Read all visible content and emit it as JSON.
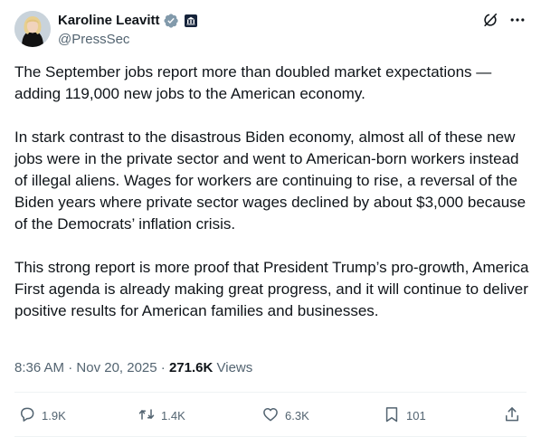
{
  "author": {
    "name": "Karoline Leavitt",
    "handle": "@PressSec"
  },
  "tweet": {
    "paragraphs": [
      "The September jobs report more than doubled market expectations — adding 119,000 new jobs to the American economy.",
      "In stark contrast to the disastrous Biden economy, almost all of these new jobs were in the private sector and went to American-born workers instead of illegal aliens. Wages for workers are continuing to rise, a reversal of the Biden years where private sector wages declined by about $3,000 because of the Democrats’ inflation crisis.",
      "This strong report is more proof that President Trump’s pro-growth, America First agenda is already making great progress, and it will continue to deliver positive results for American families and businesses."
    ]
  },
  "meta": {
    "time": "8:36 AM",
    "dot1": " · ",
    "date": "Nov 20, 2025",
    "dot2": " · ",
    "views_count": "271.6K",
    "views_label": " Views"
  },
  "actions": {
    "replies": "1.9K",
    "reposts": "1.4K",
    "likes": "6.3K",
    "bookmarks": "101"
  },
  "colors": {
    "text": "#0f1419",
    "secondary": "#536471",
    "verified": "#829aab",
    "divider": "#eff3f4"
  },
  "icons": {
    "verified": "verified-badge-icon",
    "affiliation": "government-affiliation-icon",
    "grok": "grok-icon",
    "more": "more-icon",
    "reply": "reply-icon",
    "repost": "repost-icon",
    "like": "heart-icon",
    "bookmark": "bookmark-icon",
    "share": "share-icon"
  }
}
